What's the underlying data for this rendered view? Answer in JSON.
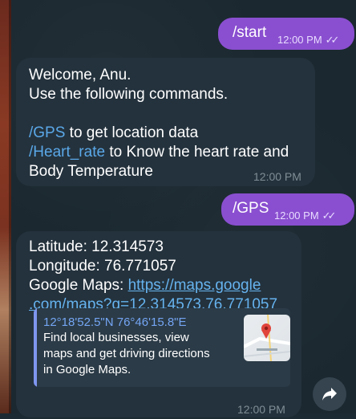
{
  "messages": {
    "start_cmd": {
      "text": "/start",
      "time": "12:00 PM"
    },
    "welcome": {
      "line1": "Welcome, Anu.",
      "line2": "Use the following commands.",
      "gps_cmd": "/GPS",
      "gps_desc": " to get location data",
      "hr_cmd": "/Heart_rate",
      "hr_desc": " to Know the heart rate and",
      "hr_desc2": "Body Temperature",
      "time": "12:00 PM"
    },
    "gps_cmd_msg": {
      "text": "/GPS",
      "time": "12:00 PM"
    },
    "location": {
      "lat": "Latitude: 12.314573",
      "lng": "Longitude: 76.771057",
      "maps_label": "Google Maps: ",
      "link_part1": "https://maps.google",
      "link_part2": ".com/maps?q=12.314573,76.771057",
      "preview_title": "12°18'52.5\"N 76°46'15.8\"E",
      "preview_desc": "Find local businesses, view maps and get driving directions in Google Maps.",
      "time": "12:00 PM"
    }
  },
  "icons": {
    "read_ticks": "double-check-icon",
    "forward": "share-forward-icon",
    "map_pin": "map-pin-icon"
  },
  "colors": {
    "outgoing_bubble": "#8a4fd0",
    "incoming_bubble": "#24323d",
    "command_link": "#5aa8e8",
    "preview_accent": "#7f96f0"
  }
}
